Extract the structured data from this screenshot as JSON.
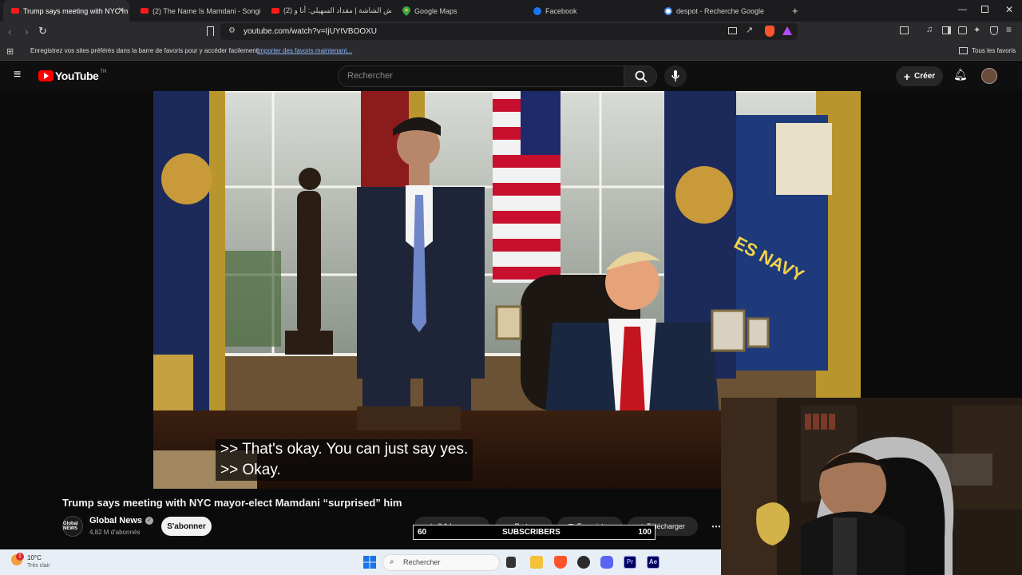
{
  "tabs": [
    {
      "label": "Trump says meeting with NYC m",
      "active": true
    },
    {
      "label": "(2) The Name Is Mamdani - Songify t",
      "active": false
    },
    {
      "label": "(2) وحش الشاشة | مقداد السهيلي: أنا و",
      "active": false
    },
    {
      "label": "Google Maps",
      "active": false
    },
    {
      "label": "Facebook",
      "active": false
    },
    {
      "label": "despot - Recherche Google",
      "active": false
    }
  ],
  "address_bar": {
    "url": "youtube.com/watch?v=IjUYtVBOOXU"
  },
  "bookmarks_bar": {
    "prompt": "Enregistrez vos sites préférés dans la barre de favoris pour y accéder facilement.",
    "import_link": "Importer des favoris maintenant...",
    "all_favorites": "Tous les favoris"
  },
  "youtube": {
    "logo_text": "YouTube",
    "logo_region": "TN",
    "search_placeholder": "Rechercher",
    "create_label": "Créer"
  },
  "video": {
    "caption_line1": ">> That's okay. You can just say yes.",
    "caption_line2": ">> Okay.",
    "flag_text": "ES NAVY",
    "title": "Trump says meeting with NYC mayor-elect Mamdani “surprised” him",
    "channel_name": "Global News",
    "channel_avatar_text": "Global NEWS",
    "subscribers": "4,82 M d'abonnés",
    "subscribe_label": "S'abonner",
    "like_count": "3,1 k",
    "share_label": "Partager",
    "save_label": "Enregistrer",
    "download_label": "Télécharger"
  },
  "sub_goal": {
    "current": "60",
    "label": "SUBSCRIBERS",
    "target": "100"
  },
  "taskbar": {
    "temperature": "10°C",
    "weather": "Très clair",
    "notification_count": "1",
    "search_placeholder": "Rechercher"
  }
}
